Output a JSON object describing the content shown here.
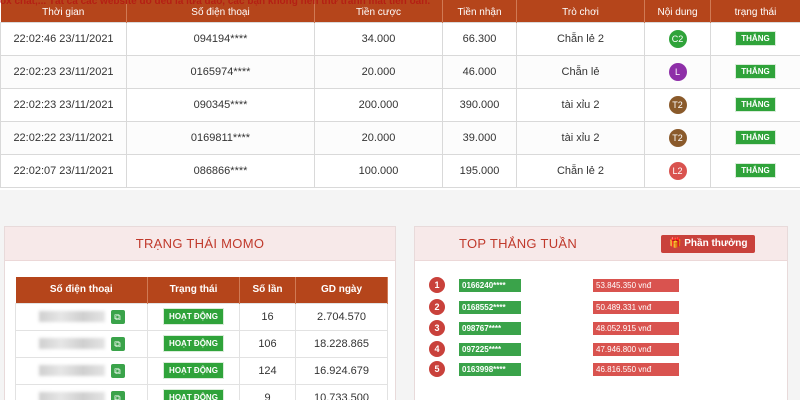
{
  "notice": "ox chat,... Tất cả các website đó đều là lừa đảo, các bạn không nên thử tránh mất tiền oan.",
  "history": {
    "headers": [
      "Thời gian",
      "Số điện thoại",
      "Tiền cược",
      "Tiền nhận",
      "Trò chơi",
      "Nội dung",
      "trạng thái"
    ],
    "rows": [
      {
        "time": "22:02:46 23/11/2021",
        "phone": "094194****",
        "bet": "34.000",
        "received": "66.300",
        "game": "Chẵn lẻ 2",
        "content": "C2",
        "content_color": "#2fa33a",
        "status": "THẮNG"
      },
      {
        "time": "22:02:23 23/11/2021",
        "phone": "0165974****",
        "bet": "20.000",
        "received": "46.000",
        "game": "Chẵn lẻ",
        "content": "L",
        "content_color": "#8e2fa8",
        "status": "THẮNG"
      },
      {
        "time": "22:02:23 23/11/2021",
        "phone": "090345****",
        "bet": "200.000",
        "received": "390.000",
        "game": "tài xỉu 2",
        "content": "T2",
        "content_color": "#8a5a2b",
        "status": "THẮNG"
      },
      {
        "time": "22:02:22 23/11/2021",
        "phone": "0169811****",
        "bet": "20.000",
        "received": "39.000",
        "game": "tài xỉu 2",
        "content": "T2",
        "content_color": "#8a5a2b",
        "status": "THẮNG"
      },
      {
        "time": "22:02:07 23/11/2021",
        "phone": "086866****",
        "bet": "100.000",
        "received": "195.000",
        "game": "Chẵn lẻ 2",
        "content": "L2",
        "content_color": "#d9534f",
        "status": "THẮNG"
      }
    ]
  },
  "momo": {
    "title": "TRẠNG THÁI MOMO",
    "headers": [
      "Số điện thoại",
      "Trạng thái",
      "Số lần",
      "GD ngày"
    ],
    "rows": [
      {
        "status": "HOẠT ĐỘNG",
        "count": "16",
        "daily": "2.704.570"
      },
      {
        "status": "HOẠT ĐỘNG",
        "count": "106",
        "daily": "18.228.865"
      },
      {
        "status": "HOẠT ĐỘNG",
        "count": "124",
        "daily": "16.924.679"
      },
      {
        "status": "HOẠT ĐỘNG",
        "count": "9",
        "daily": "10.733.500"
      }
    ]
  },
  "weekly": {
    "title": "TOP THẮNG TUẦN",
    "reward_label": "Phần thưởng",
    "ranks": [
      {
        "rank": "1",
        "phone": "0166240****",
        "amount": "53.845.350 vnđ"
      },
      {
        "rank": "2",
        "phone": "0168552****",
        "amount": "50.489.331 vnđ"
      },
      {
        "rank": "3",
        "phone": "098767****",
        "amount": "48.052.915 vnđ"
      },
      {
        "rank": "4",
        "phone": "097225****",
        "amount": "47.946.800 vnđ"
      },
      {
        "rank": "5",
        "phone": "0163998****",
        "amount": "46.816.550 vnđ"
      }
    ]
  },
  "colors": {
    "header": "#b5451b",
    "win": "#2fa33a",
    "accent": "#c9413b"
  },
  "icons": {
    "copy": "copy-icon",
    "reward": "gift-icon"
  }
}
